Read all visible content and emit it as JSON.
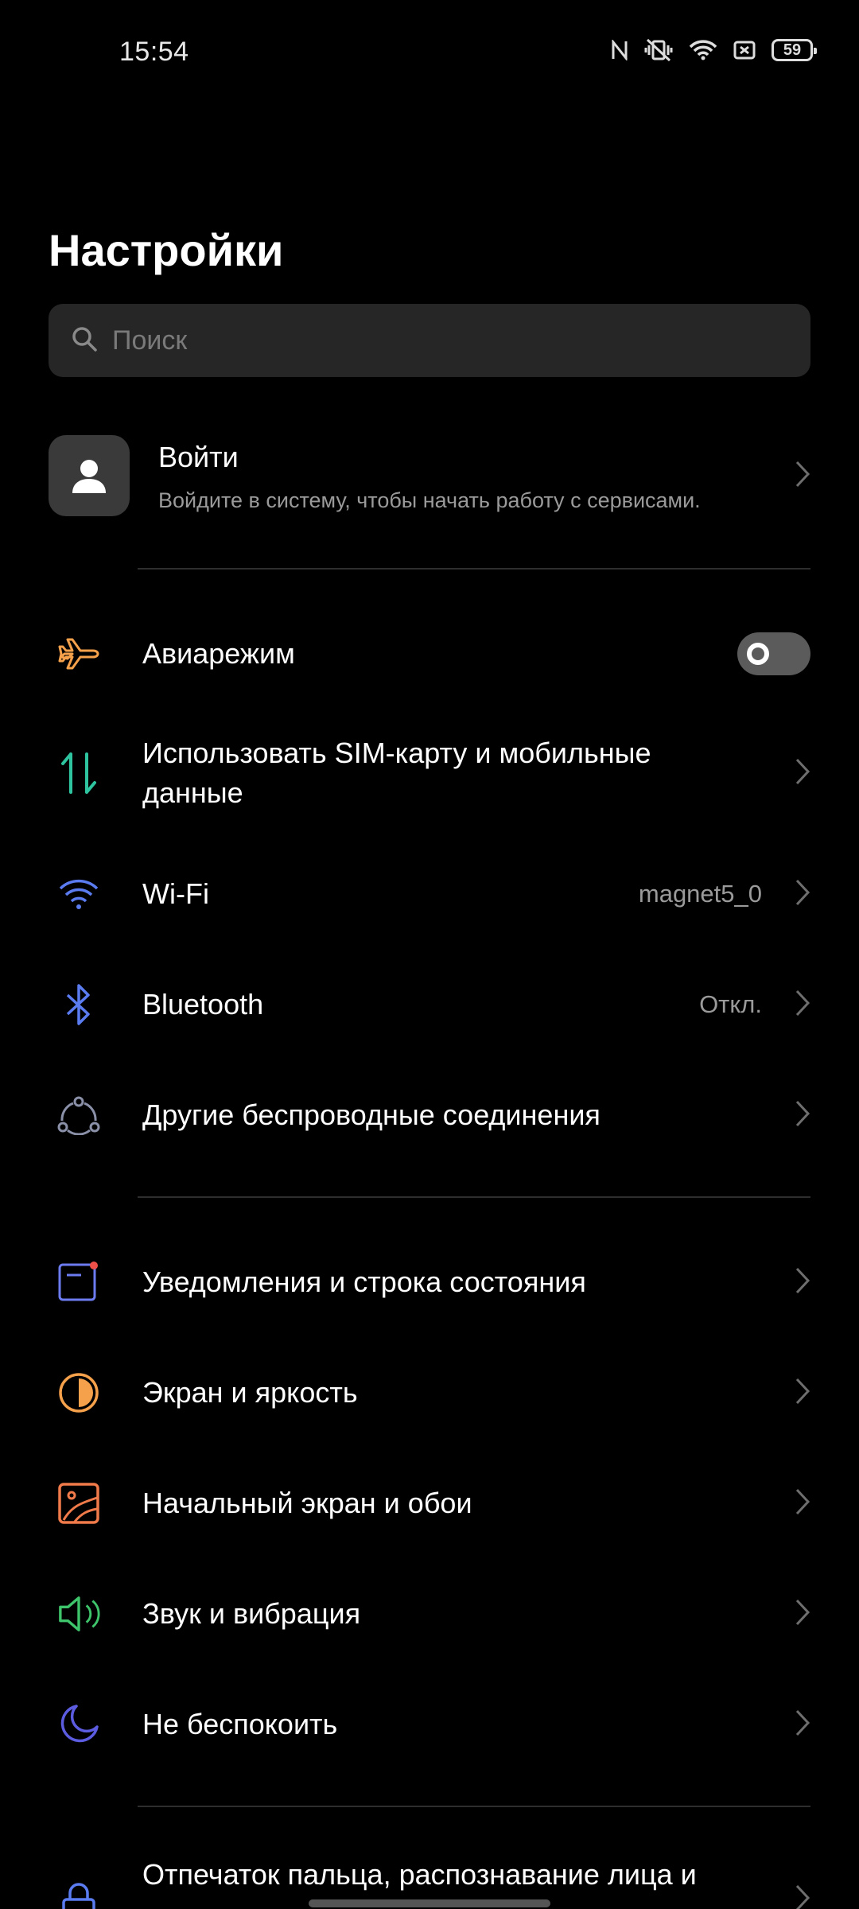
{
  "status_bar": {
    "time": "15:54",
    "battery": "59",
    "icons": [
      "nfc-icon",
      "vibrate-off-icon",
      "wifi-icon",
      "sim-off-icon",
      "battery-icon"
    ]
  },
  "page": {
    "title": "Настройки"
  },
  "search": {
    "placeholder": "Поиск"
  },
  "account": {
    "title": "Войти",
    "subtitle": "Войдите в систему, чтобы начать работу с сервисами."
  },
  "rows": [
    {
      "label": "Авиарежим",
      "icon": "airplane-icon",
      "icon_color": "#f5a04a",
      "toggle": false
    },
    {
      "label": "Использовать SIM-карту и мобильные данные",
      "icon": "mobile-data-icon",
      "icon_color": "#2ec4a0"
    },
    {
      "label": "Wi-Fi",
      "value": "magnet5_0",
      "icon": "wifi-icon",
      "icon_color": "#5b7cf0"
    },
    {
      "label": "Bluetooth",
      "value": "Откл.",
      "icon": "bluetooth-icon",
      "icon_color": "#5b7cf0"
    },
    {
      "label": "Другие беспроводные соединения",
      "icon": "connections-icon",
      "icon_color": "#8a90a8"
    },
    {
      "label": "Уведомления и строка состояния",
      "icon": "notifications-icon",
      "icon_color": "#6c7cf0"
    },
    {
      "label": "Экран и яркость",
      "icon": "brightness-icon",
      "icon_color": "#f5a04a"
    },
    {
      "label": "Начальный экран и обои",
      "icon": "wallpaper-icon",
      "icon_color": "#f07a4a"
    },
    {
      "label": "Звук и вибрация",
      "icon": "sound-icon",
      "icon_color": "#3ec46a"
    },
    {
      "label": "Не беспокоить",
      "icon": "moon-icon",
      "icon_color": "#5b5ce0"
    },
    {
      "label": "Отпечаток пальца, распознавание лица и",
      "icon": "lock-icon",
      "icon_color": "#5b7cf0"
    }
  ]
}
